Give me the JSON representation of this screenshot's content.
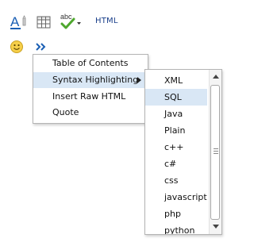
{
  "toolbar": {
    "row1": [
      {
        "name": "font-style-button",
        "icon": "text-color-icon"
      },
      {
        "name": "table-button",
        "icon": "table-icon"
      },
      {
        "name": "spellcheck-button",
        "icon": "spellcheck-icon",
        "label": "abc"
      },
      {
        "name": "html-button",
        "label": "HTML"
      }
    ],
    "html_label": "HTML",
    "spell_label": "abc",
    "font_letter": "A",
    "emoticon_icon": "smiley-icon",
    "more_icon": "double-chevron-right-icon"
  },
  "main_menu": {
    "items": [
      {
        "label": "Table of Contents"
      },
      {
        "label": "Syntax Highlighting",
        "has_submenu": true,
        "active": true
      },
      {
        "label": "Insert Raw HTML"
      },
      {
        "label": "Quote"
      }
    ]
  },
  "submenu": {
    "items": [
      {
        "label": "XML"
      },
      {
        "label": "SQL",
        "selected": true
      },
      {
        "label": "Java"
      },
      {
        "label": "Plain"
      },
      {
        "label": "c++"
      },
      {
        "label": "c#"
      },
      {
        "label": "css"
      },
      {
        "label": "javascript"
      },
      {
        "label": "php"
      },
      {
        "label": "python"
      }
    ],
    "selected": "SQL"
  },
  "colors": {
    "accent_blue": "#1a5fb4",
    "highlight": "#d9e7f5",
    "menu_border": "#b4b4b4",
    "check_green": "#4ea72e"
  }
}
